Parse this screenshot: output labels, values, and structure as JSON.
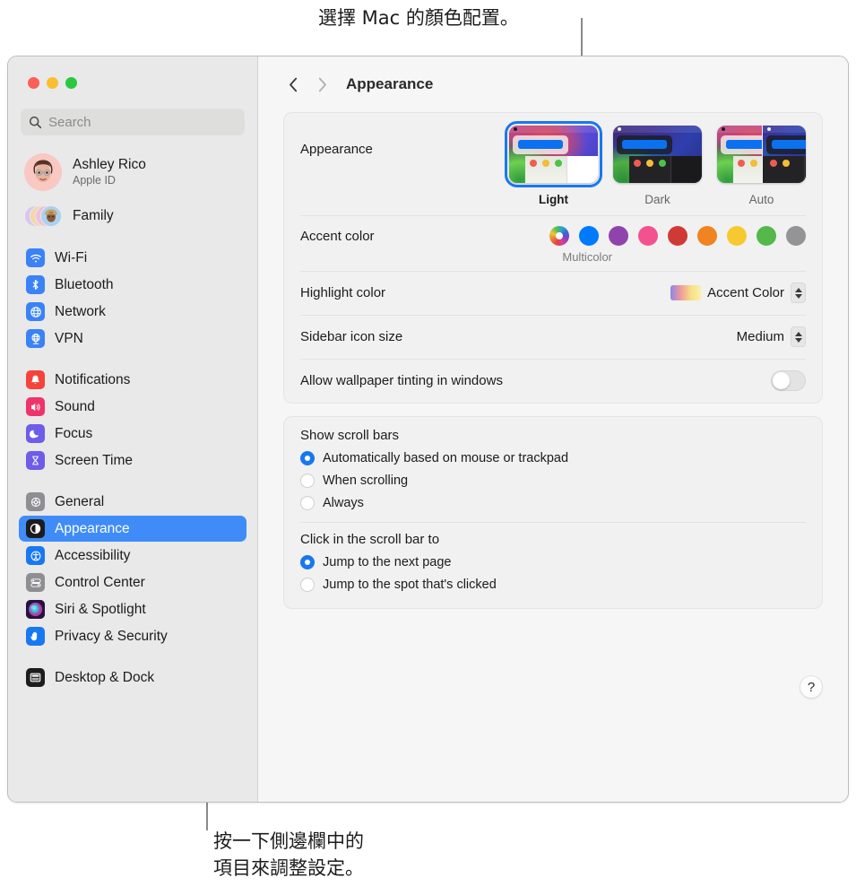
{
  "callouts": {
    "top": "選擇 Mac 的顏色配置。",
    "bottom": "按一下側邊欄中的\n項目來調整設定。"
  },
  "window": {
    "traffic_lights": [
      "close",
      "minimize",
      "zoom"
    ]
  },
  "sidebar": {
    "search": {
      "placeholder": "Search",
      "icon": "search-icon"
    },
    "account": {
      "name": "Ashley Rico",
      "subtitle": "Apple ID",
      "avatar": "memoji-avatar"
    },
    "family": {
      "label": "Family",
      "icon": "family-avatars"
    },
    "groups": [
      {
        "items": [
          {
            "label": "Wi-Fi",
            "icon": "wifi-icon",
            "color": "#3b82f6",
            "selected": false
          },
          {
            "label": "Bluetooth",
            "icon": "bluetooth-icon",
            "color": "#3b82f6",
            "selected": false
          },
          {
            "label": "Network",
            "icon": "globe-icon",
            "color": "#3b82f6",
            "selected": false
          },
          {
            "label": "VPN",
            "icon": "vpn-globe-icon",
            "color": "#3b82f6",
            "selected": false
          }
        ]
      },
      {
        "items": [
          {
            "label": "Notifications",
            "icon": "bell-icon",
            "color": "#f6433b",
            "selected": false
          },
          {
            "label": "Sound",
            "icon": "speaker-icon",
            "color": "#f0336b",
            "selected": false
          },
          {
            "label": "Focus",
            "icon": "moon-icon",
            "color": "#6d5de8",
            "selected": false
          },
          {
            "label": "Screen Time",
            "icon": "hourglass-icon",
            "color": "#6d5de8",
            "selected": false
          }
        ]
      },
      {
        "items": [
          {
            "label": "General",
            "icon": "gear-icon",
            "color": "#8e8e93",
            "selected": false
          },
          {
            "label": "Appearance",
            "icon": "appearance-icon",
            "color": "#1c1c1e",
            "selected": true
          },
          {
            "label": "Accessibility",
            "icon": "accessibility-icon",
            "color": "#1878f0",
            "selected": false
          },
          {
            "label": "Control Center",
            "icon": "control-center-icon",
            "color": "#8e8e93",
            "selected": false
          },
          {
            "label": "Siri & Spotlight",
            "icon": "siri-icon",
            "color": "#2a1040",
            "selected": false
          },
          {
            "label": "Privacy & Security",
            "icon": "hand-icon",
            "color": "#1878f0",
            "selected": false
          }
        ]
      },
      {
        "items": [
          {
            "label": "Desktop & Dock",
            "icon": "desktop-dock-icon",
            "color": "#1c1c1e",
            "selected": false
          }
        ]
      }
    ]
  },
  "toolbar": {
    "back_icon": "chevron-left-icon",
    "forward_icon": "chevron-right-icon",
    "title": "Appearance"
  },
  "main": {
    "appearance": {
      "label": "Appearance",
      "options": [
        {
          "label": "Light",
          "selected": true
        },
        {
          "label": "Dark",
          "selected": false
        },
        {
          "label": "Auto",
          "selected": false
        }
      ]
    },
    "accent_color": {
      "label": "Accent color",
      "selected_label": "Multicolor",
      "swatches": [
        {
          "name": "Multicolor",
          "color": "multicolor",
          "selected": true
        },
        {
          "name": "Blue",
          "color": "#017aff"
        },
        {
          "name": "Purple",
          "color": "#8f44ad"
        },
        {
          "name": "Pink",
          "color": "#f2528f"
        },
        {
          "name": "Red",
          "color": "#d03a36"
        },
        {
          "name": "Orange",
          "color": "#ef8420"
        },
        {
          "name": "Yellow",
          "color": "#f6c931"
        },
        {
          "name": "Green",
          "color": "#54b84b"
        },
        {
          "name": "Graphite",
          "color": "#949497"
        }
      ]
    },
    "highlight_color": {
      "label": "Highlight color",
      "value": "Accent Color"
    },
    "sidebar_icon_size": {
      "label": "Sidebar icon size",
      "value": "Medium"
    },
    "wallpaper_tinting": {
      "label": "Allow wallpaper tinting in windows",
      "value": "off"
    },
    "show_scroll_bars": {
      "label": "Show scroll bars",
      "options": [
        {
          "label": "Automatically based on mouse or trackpad",
          "selected": true
        },
        {
          "label": "When scrolling",
          "selected": false
        },
        {
          "label": "Always",
          "selected": false
        }
      ]
    },
    "click_scroll_bar": {
      "label": "Click in the scroll bar to",
      "options": [
        {
          "label": "Jump to the next page",
          "selected": true
        },
        {
          "label": "Jump to the spot that's clicked",
          "selected": false
        }
      ]
    },
    "help_button": {
      "label": "?",
      "icon": "help-icon"
    }
  }
}
